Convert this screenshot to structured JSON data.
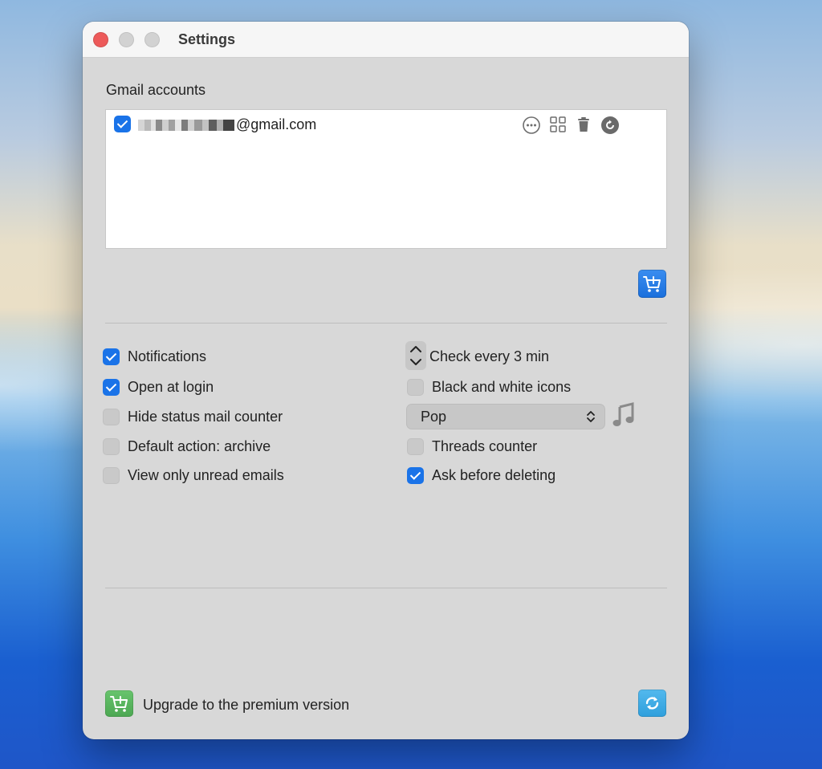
{
  "window": {
    "title": "Settings"
  },
  "accounts": {
    "section_label": "Gmail accounts",
    "items": [
      {
        "email_suffix": "@gmail.com",
        "checked": true,
        "actions": [
          "more-icon",
          "grid-icon",
          "trash-icon",
          "refresh-circle-icon"
        ]
      }
    ]
  },
  "buttons": {
    "add_account_icon": "cart-plus-icon",
    "upgrade_icon": "cart-plus-icon",
    "refresh_icon": "refresh-icon"
  },
  "options_left": [
    {
      "label": "Notifications",
      "checked": true
    },
    {
      "label": "Open at login",
      "checked": true
    },
    {
      "label": "Hide status mail counter",
      "checked": false
    },
    {
      "label": "Default action: archive",
      "checked": false
    },
    {
      "label": "View only unread emails",
      "checked": false
    }
  ],
  "options_right": {
    "check_interval_label": "Check every 3 min",
    "black_white_icons": {
      "label": "Black and white icons",
      "checked": false
    },
    "sound_select_value": "Pop",
    "threads_counter": {
      "label": "Threads counter",
      "checked": false
    },
    "ask_before_deleting": {
      "label": "Ask before deleting",
      "checked": true
    }
  },
  "footer": {
    "upgrade_label": "Upgrade to the premium version"
  },
  "colors": {
    "accent": "#1a73e8",
    "upgrade_green": "#5cb862",
    "refresh_blue": "#3aa9e4"
  }
}
